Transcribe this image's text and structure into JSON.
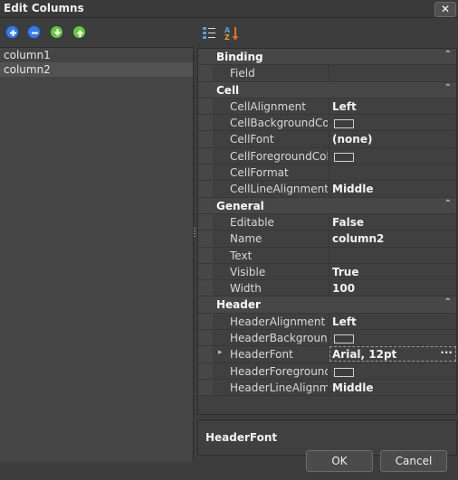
{
  "window": {
    "title": "Edit Columns",
    "close_label": "✕"
  },
  "left_toolbar": {
    "icons": [
      "add-icon",
      "remove-icon",
      "move-down-icon",
      "move-up-icon"
    ],
    "colors": {
      "add": "#3a7be0",
      "remove": "#3a7be0",
      "move_down": "#6cc24a",
      "move_up": "#6cc24a"
    }
  },
  "right_toolbar": {
    "icons": [
      "categorized-icon",
      "alphabetical-icon"
    ]
  },
  "columns_list": [
    {
      "label": "column1",
      "selected": false
    },
    {
      "label": "column2",
      "selected": true
    }
  ],
  "grid": {
    "categories": {
      "binding": "Binding",
      "cell": "Cell",
      "general": "General",
      "header": "Header"
    },
    "binding": {
      "field": "Field"
    },
    "cell": {
      "cell_alignment": {
        "name": "CellAlignment",
        "value": "Left"
      },
      "cell_background_color": {
        "name": "CellBackgroundColor"
      },
      "cell_font": {
        "name": "CellFont",
        "value": "(none)"
      },
      "cell_foreground_color": {
        "name": "CellForegroundColor"
      },
      "cell_format": {
        "name": "CellFormat"
      },
      "cell_line_alignment": {
        "name": "CellLineAlignment",
        "value": "Middle"
      }
    },
    "general": {
      "editable": {
        "name": "Editable",
        "value": "False"
      },
      "name": {
        "name": "Name",
        "value": "column2"
      },
      "text": {
        "name": "Text"
      },
      "visible": {
        "name": "Visible",
        "value": "True"
      },
      "width": {
        "name": "Width",
        "value": "100"
      }
    },
    "header": {
      "header_alignment": {
        "name": "HeaderAlignment",
        "value": "Left"
      },
      "header_background_color": {
        "name": "HeaderBackgroundColor"
      },
      "header_font": {
        "name": "HeaderFont",
        "value": "Arial, 12pt",
        "ellipsis": "···"
      },
      "header_foreground_color": {
        "name": "HeaderForegroundColor"
      },
      "header_line_alignment": {
        "name": "HeaderLineAlignment",
        "value": "Middle"
      }
    }
  },
  "description": {
    "title": "HeaderFont"
  },
  "buttons": {
    "ok": "OK",
    "cancel": "Cancel"
  }
}
